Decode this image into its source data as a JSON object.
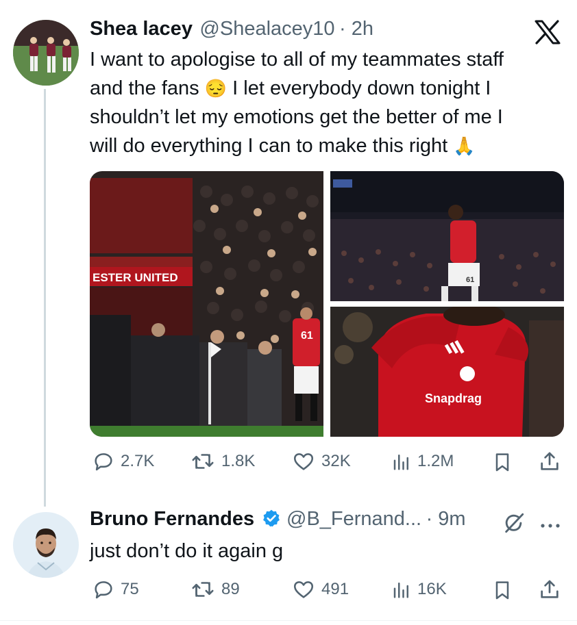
{
  "tweet1": {
    "name": "Shea lacey",
    "handle": "@Shealacey10",
    "time": "· 2h",
    "text_line1": "I want to apologise to all of my teammates staff",
    "text_line2_a": "and the fans",
    "text_line2_b": "I let everybody down tonight I",
    "text_line3": "shouldn’t let my emotions get the better of me I",
    "text_line4": "will do everything I can to make this right",
    "emoji_pensive": "😔",
    "emoji_pray": "🙏",
    "media": {
      "tile1_sign": "ESTER UNITED",
      "tile1_shirt_number": "61",
      "tile2_shirt_number": "61",
      "tile3_sponsor": "Snapdrag"
    },
    "stats": {
      "replies": "2.7K",
      "reposts": "1.8K",
      "likes": "32K",
      "views": "1.2M"
    }
  },
  "tweet2": {
    "name": "Bruno Fernandes",
    "handle": "@B_Fernand...",
    "time": "· 9m",
    "text": "just don’t do it again g",
    "stats": {
      "replies": "75",
      "reposts": "89",
      "likes": "491",
      "views": "16K"
    }
  },
  "icons": {
    "x_logo": "x-logo-icon",
    "verified": "verified-badge-icon",
    "grok": "grok-icon",
    "more": "more-icon"
  },
  "colors": {
    "text": "#0f1419",
    "muted": "#536471",
    "verified": "#1d9bf0",
    "thread_line": "#cfd9de",
    "united_red": "#c8102e"
  }
}
